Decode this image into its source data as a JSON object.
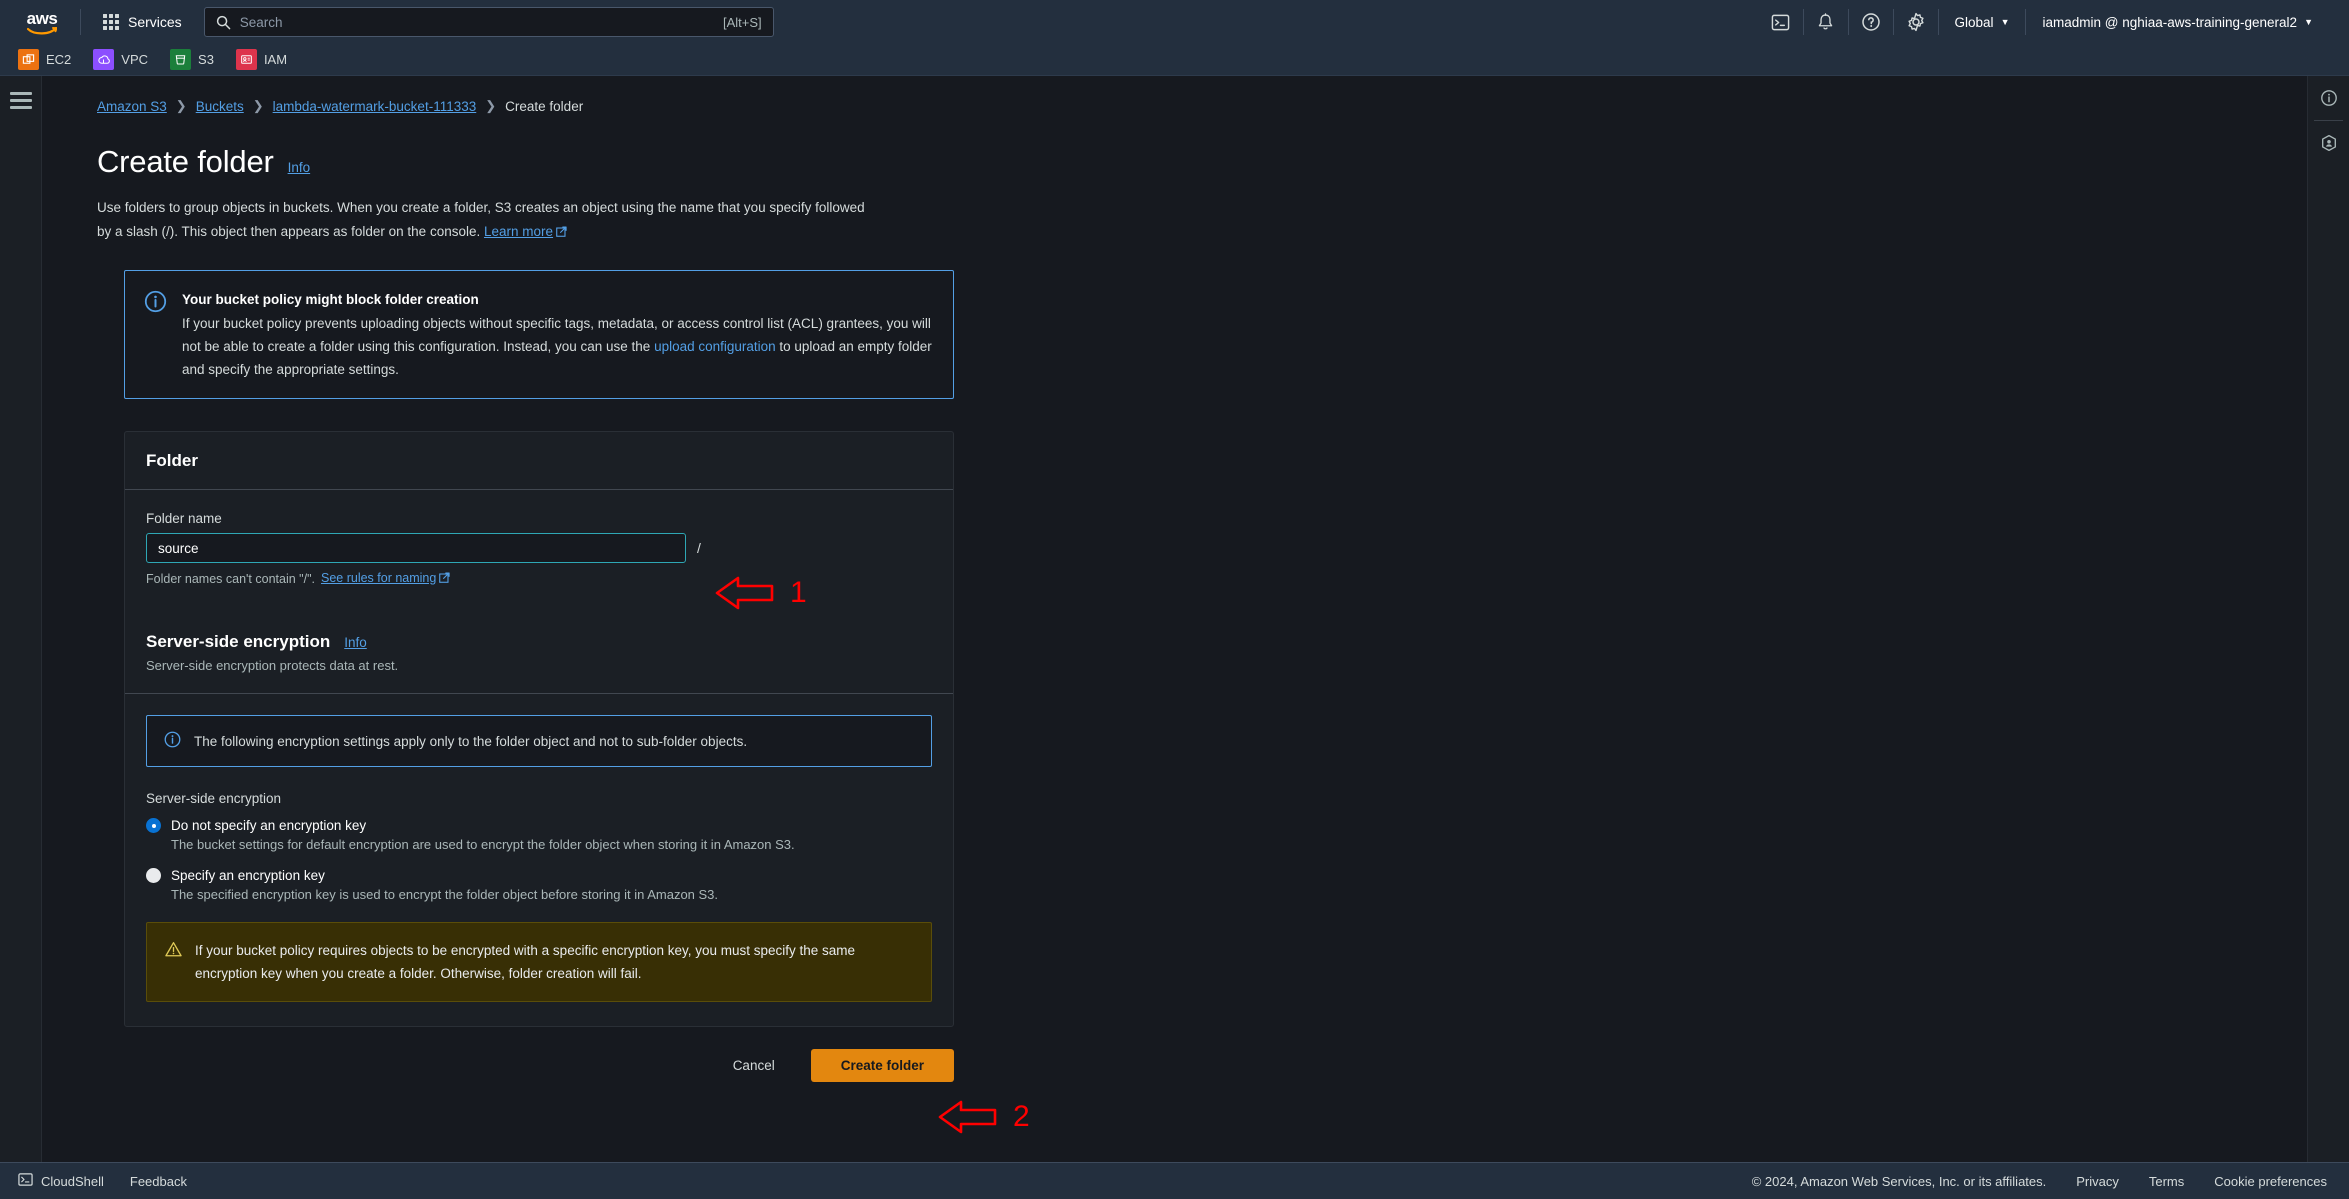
{
  "topnav": {
    "logo_text": "aws",
    "services_label": "Services",
    "search": {
      "placeholder": "Search",
      "shortcut": "[Alt+S]"
    },
    "icons": [
      {
        "name": "cloudshell-icon",
        "title": "CloudShell"
      },
      {
        "name": "notifications-bell-icon",
        "title": "Notifications"
      },
      {
        "name": "help-question-icon",
        "title": "Help"
      },
      {
        "name": "settings-gear-icon",
        "title": "Settings"
      }
    ],
    "region_label": "Global",
    "account_label": "iamadmin @ nghiaa-aws-training-general2"
  },
  "shortcuts": [
    {
      "label": "EC2",
      "color": "#ec7211",
      "icon": "ec2-icon"
    },
    {
      "label": "VPC",
      "color": "#8c4fff",
      "icon": "vpc-icon"
    },
    {
      "label": "S3",
      "color": "#1b7f3b",
      "icon": "s3-bucket-icon"
    },
    {
      "label": "IAM",
      "color": "#dd344c",
      "icon": "iam-icon"
    }
  ],
  "breadcrumb": [
    {
      "label": "Amazon S3",
      "link": true
    },
    {
      "label": "Buckets",
      "link": true
    },
    {
      "label": "lambda-watermark-bucket-111333",
      "link": true
    },
    {
      "label": "Create folder",
      "link": false
    }
  ],
  "header": {
    "title": "Create folder",
    "info_label": "Info",
    "description_part1": "Use folders to group objects in buckets. When you create a folder, S3 creates an object using the name that you specify followed by a slash (/). This object then appears as folder on the console.",
    "learn_more_label": "Learn more"
  },
  "policy_alert": {
    "heading": "Your bucket policy might block folder creation",
    "body_part1": "If your bucket policy prevents uploading objects without specific tags, metadata, or access control list (ACL) grantees, you will not be able to create a folder using this configuration. Instead, you can use the ",
    "link_label": "upload configuration",
    "body_part2": " to upload an empty folder and specify the appropriate settings.",
    "icon": "info-circle-icon"
  },
  "folder_section": {
    "card_title": "Folder",
    "field_label": "Folder name",
    "field_value": "source",
    "field_placeholder": "",
    "slash": "/",
    "hint_text": "Folder names can't contain \"/\".",
    "hint_link": "See rules for naming"
  },
  "encryption_section": {
    "title": "Server-side encryption",
    "info_label": "Info",
    "subtitle": "Server-side encryption protects data at rest.",
    "notice": "The following encryption settings apply only to the folder object and not to sub-folder objects.",
    "notice_icon": "info-circle-icon",
    "group_label": "Server-side encryption",
    "options": [
      {
        "label": "Do not specify an encryption key",
        "description": "The bucket settings for default encryption are used to encrypt the folder object when storing it in Amazon S3.",
        "selected": true
      },
      {
        "label": "Specify an encryption key",
        "description": "The specified encryption key is used to encrypt the folder object before storing it in Amazon S3.",
        "selected": false
      }
    ],
    "warning": "If your bucket policy requires objects to be encrypted with a specific encryption key, you must specify the same encryption key when you create a folder. Otherwise, folder creation will fail.",
    "warning_icon": "warning-triangle-icon"
  },
  "actions": {
    "cancel_label": "Cancel",
    "submit_label": "Create folder"
  },
  "annotations": [
    {
      "number": "1",
      "target": "folder-name-input",
      "color": "#ff0000"
    },
    {
      "number": "2",
      "target": "create-folder-button",
      "color": "#ff0000"
    }
  ],
  "right_rail": [
    {
      "name": "info-panel-icon"
    },
    {
      "name": "recent-history-icon"
    }
  ],
  "footer": {
    "cloudshell_label": "CloudShell",
    "feedback_label": "Feedback",
    "copyright": "© 2024, Amazon Web Services, Inc. or its affiliates.",
    "links": [
      "Privacy",
      "Terms",
      "Cookie preferences"
    ]
  },
  "colors": {
    "nav_bg": "#232f3e",
    "page_bg": "#16191f",
    "card_bg": "#1b1f25",
    "link": "#539fe5",
    "primary_button": "#e3870f",
    "input_focus_border": "#2ea7b5",
    "radio_selected": "#0972d3",
    "warning_bg": "#382f05",
    "annotation": "#ff0000"
  }
}
